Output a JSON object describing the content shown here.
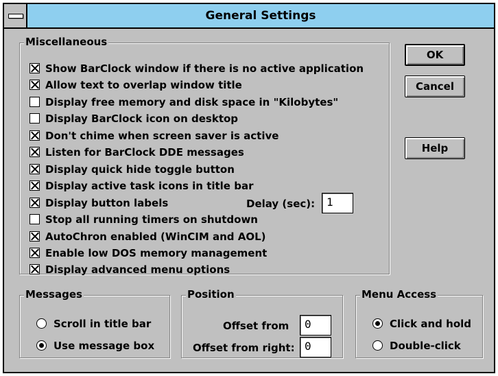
{
  "window": {
    "title": "General Settings",
    "system_menu_icon": "system-menu-icon"
  },
  "misc": {
    "label": "Miscellaneous",
    "options": [
      {
        "label": "Show BarClock window if there is no active application",
        "checked": true
      },
      {
        "label": "Allow text to overlap window title",
        "checked": true
      },
      {
        "label": "Display free memory and disk space in \"Kilobytes\"",
        "checked": false
      },
      {
        "label": "Display BarClock icon on desktop",
        "checked": false
      },
      {
        "label": "Don't chime when screen saver is active",
        "checked": true
      },
      {
        "label": "Listen for BarClock DDE messages",
        "checked": true
      },
      {
        "label": "Display quick hide toggle button",
        "checked": true
      },
      {
        "label": "Display active task icons in title bar",
        "checked": true
      },
      {
        "label": "Display button labels",
        "checked": true
      },
      {
        "label": "Stop all running timers on shutdown",
        "checked": false
      },
      {
        "label": "AutoChron enabled (WinCIM and AOL)",
        "checked": true
      },
      {
        "label": "Enable low DOS memory management",
        "checked": true
      },
      {
        "label": "Display advanced menu options",
        "checked": true
      }
    ],
    "delay_label": "Delay (sec):",
    "delay_value": "1"
  },
  "buttons": {
    "ok": "OK",
    "cancel": "Cancel",
    "help": "Help"
  },
  "messages": {
    "label": "Messages",
    "options": [
      {
        "label": "Scroll in title bar",
        "selected": false
      },
      {
        "label": "Use message box",
        "selected": true
      }
    ]
  },
  "position": {
    "label": "Position",
    "offset_from_label": "Offset from",
    "offset_from_value": "0",
    "offset_right_label": "Offset from right:",
    "offset_right_value": "0"
  },
  "menu_access": {
    "label": "Menu Access",
    "options": [
      {
        "label": "Click and hold",
        "selected": true
      },
      {
        "label": "Double-click",
        "selected": false
      }
    ]
  }
}
